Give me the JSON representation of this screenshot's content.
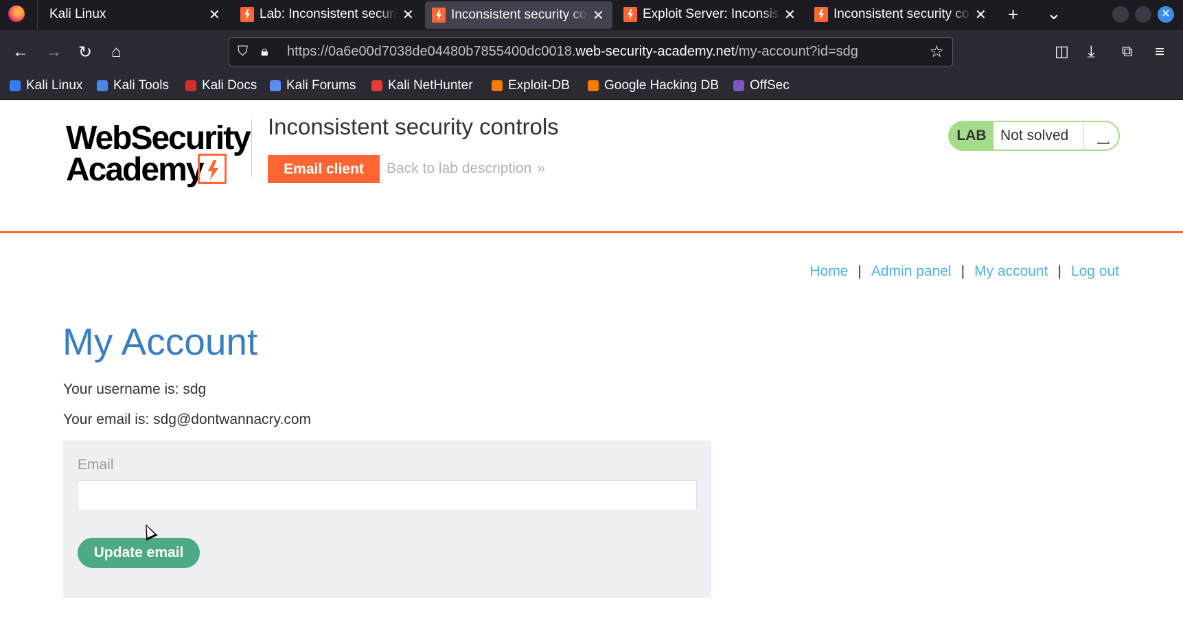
{
  "browser": {
    "tabs": [
      {
        "title": "Kali Linux",
        "active": false
      },
      {
        "title": "Lab: Inconsistent security",
        "active": false
      },
      {
        "title": "Inconsistent security co",
        "active": true
      },
      {
        "title": "Exploit Server: Inconsis",
        "active": false
      },
      {
        "title": "Inconsistent security co",
        "active": false
      }
    ],
    "new_tab": "+",
    "tab_list": "⌄",
    "url_prefix": "https://0a6e00d7038de04480b7855400dc0018.",
    "url_domain": "web-security-academy.net",
    "url_path": "/my-account?id=sdg",
    "bookmarks": [
      {
        "label": "Kali Linux",
        "color": "#367bf0"
      },
      {
        "label": "Kali Tools",
        "color": "#4a86e8"
      },
      {
        "label": "Kali Docs",
        "color": "#d32f2f"
      },
      {
        "label": "Kali Forums",
        "color": "#5b8def"
      },
      {
        "label": "Kali NetHunter",
        "color": "#e53935"
      },
      {
        "label": "Exploit-DB",
        "color": "#f57c00"
      },
      {
        "label": "Google Hacking DB",
        "color": "#f57c00"
      },
      {
        "label": "OffSec",
        "color": "#7e57c2"
      }
    ]
  },
  "header": {
    "logo_line1": "WebSecurity",
    "logo_line2": "Academy",
    "lab_title": "Inconsistent security controls",
    "email_client": "Email client",
    "back_link": "Back to lab description",
    "back_chevron": "»",
    "status_lab": "LAB",
    "status_state": "Not solved"
  },
  "nav": {
    "home": "Home",
    "admin": "Admin panel",
    "account": "My account",
    "logout": "Log out",
    "sep": "|"
  },
  "main": {
    "title": "My Account",
    "username_line": "Your username is: sdg",
    "email_line": "Your email is: sdg@dontwannacry.com",
    "form": {
      "label": "Email",
      "value": "",
      "button": "Update email"
    }
  },
  "colors": {
    "accent": "#ff6633",
    "heading": "#3a7ec2",
    "link": "#4bb4e6",
    "button_green": "#4caa84",
    "status_green": "#a4dc8c"
  }
}
